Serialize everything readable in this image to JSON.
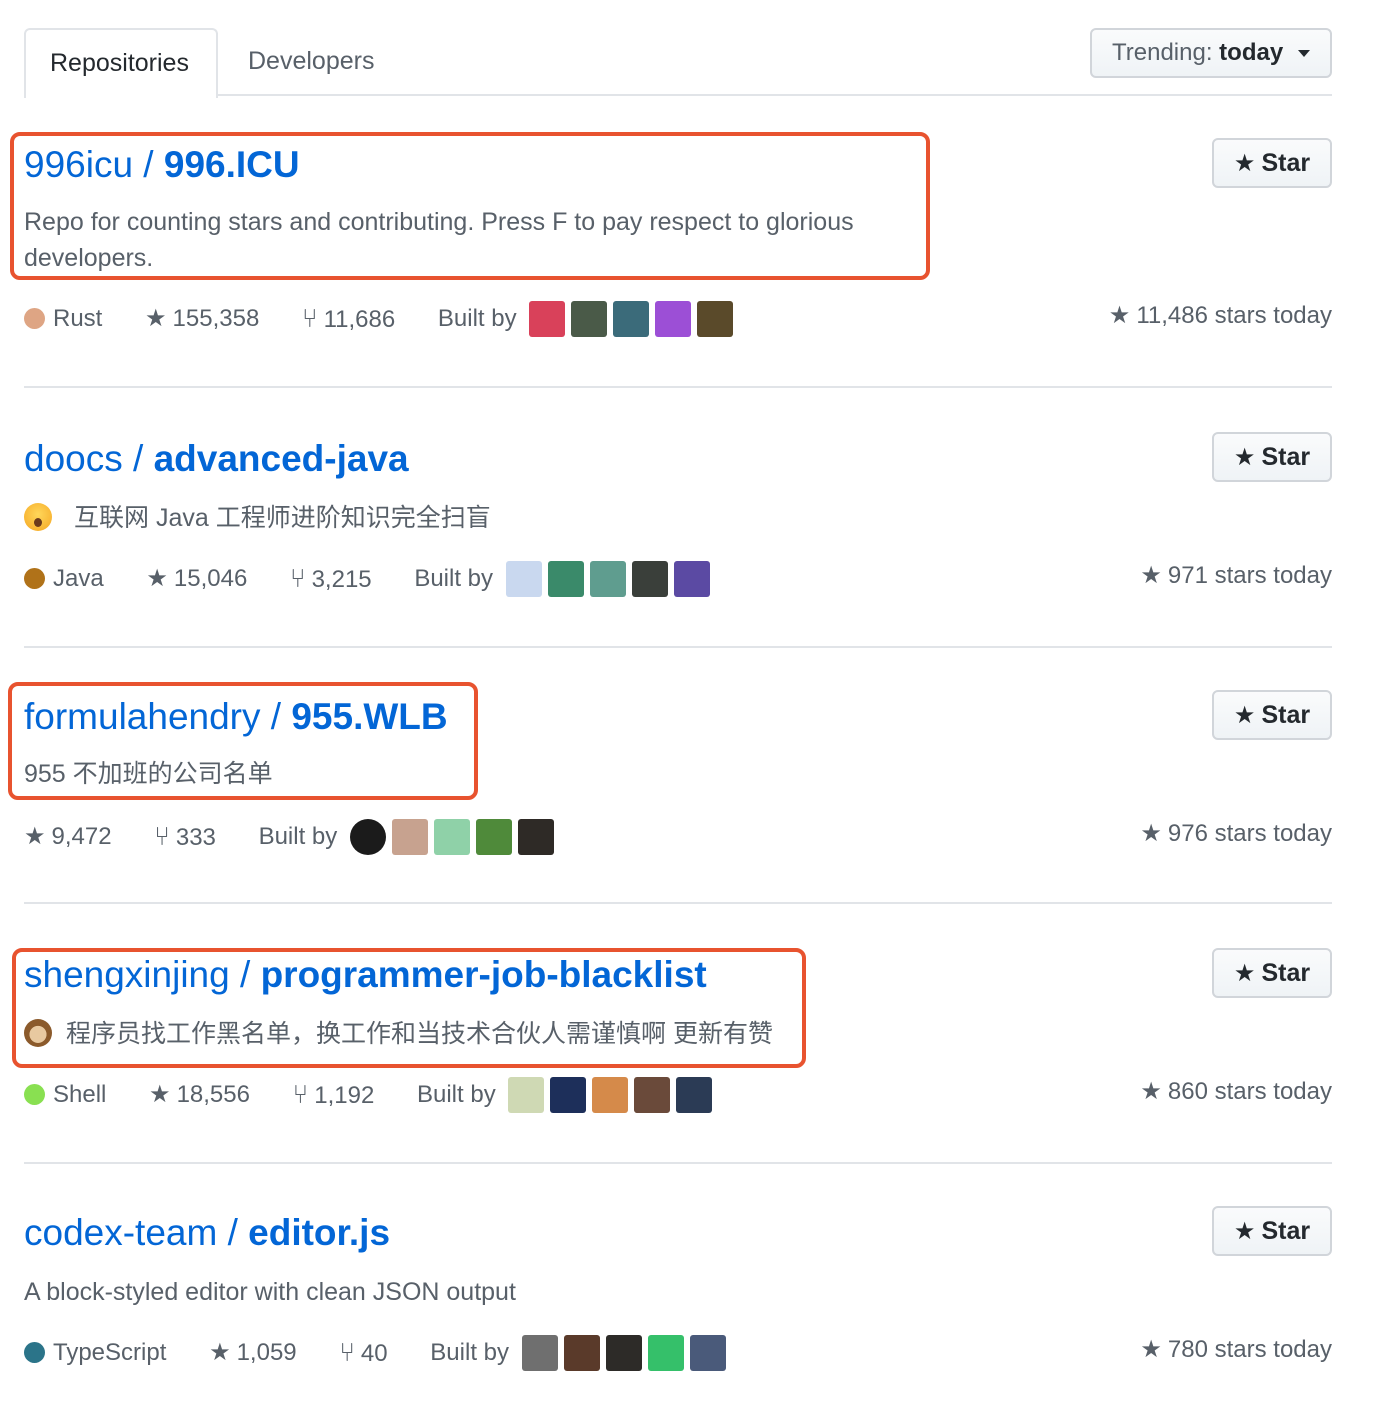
{
  "tabs": {
    "repositories": "Repositories",
    "developers": "Developers"
  },
  "trending": {
    "label": "Trending:",
    "value": "today"
  },
  "star_label": "Star",
  "built_by_label": "Built by",
  "repos": [
    {
      "owner": "996icu",
      "name": "996.ICU",
      "desc_line1": "Repo for counting stars and contributing. Press F to pay respect to glorious",
      "desc_line2": "developers.",
      "language": "Rust",
      "language_color": "#dea584",
      "stars": "155,358",
      "forks": "11,686",
      "stars_today": "11,486 stars today",
      "avatars": [
        "#d9415a",
        "#4a5a48",
        "#3b6b7a",
        "#9c4fd6",
        "#5a4a2a"
      ]
    },
    {
      "owner": "doocs",
      "name": "advanced-java",
      "desc": "互联网 Java 工程师进阶知识完全扫盲",
      "language": "Java",
      "language_color": "#b07219",
      "stars": "15,046",
      "forks": "3,215",
      "stars_today": "971 stars today",
      "avatars": [
        "#c9d8ef",
        "#3a8a6a",
        "#5f9d8f",
        "#3a3f3a",
        "#5b4aa3"
      ]
    },
    {
      "owner": "formulahendry",
      "name": "955.WLB",
      "desc": "955 不加班的公司名单",
      "stars": "9,472",
      "forks": "333",
      "stars_today": "976 stars today",
      "avatars": [
        "#1b1b1b",
        "#c7a28f",
        "#8fd1a8",
        "#4f8a3a",
        "#2e2a26"
      ]
    },
    {
      "owner": "shengxinjing",
      "name": "programmer-job-blacklist",
      "desc": "程序员找工作黑名单，换工作和当技术合伙人需谨慎啊 更新有赞",
      "language": "Shell",
      "language_color": "#89e051",
      "stars": "18,556",
      "forks": "1,192",
      "stars_today": "860 stars today",
      "avatars": [
        "#cfd9b4",
        "#1d2f5a",
        "#d58a4a",
        "#6a4a3a",
        "#2b3b55"
      ]
    },
    {
      "owner": "codex-team",
      "name": "editor.js",
      "desc": "A block-styled editor with clean JSON output",
      "language": "TypeScript",
      "language_color": "#2b7489",
      "stars": "1,059",
      "forks": "40",
      "stars_today": "780 stars today",
      "avatars": [
        "#6f6f6f",
        "#5a3a2a",
        "#2d2b28",
        "#35c06a",
        "#4a5a7a"
      ]
    }
  ],
  "colors": {
    "link": "#0366d6",
    "highlight": "#e8532f",
    "muted": "#586069"
  }
}
